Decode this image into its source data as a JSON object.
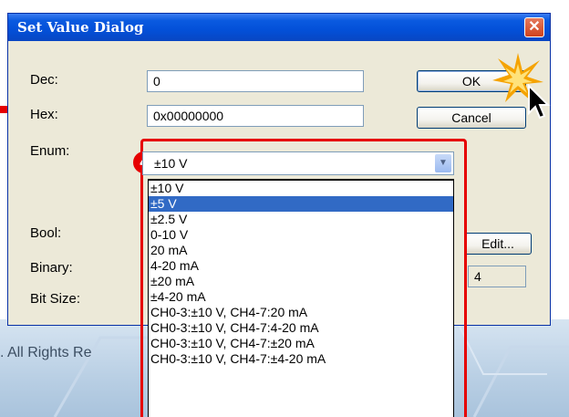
{
  "dialog": {
    "title": "Set Value Dialog",
    "close_icon": "close-icon"
  },
  "labels": {
    "dec": "Dec:",
    "hex": "Hex:",
    "enum": "Enum:",
    "bool": "Bool:",
    "binary": "Binary:",
    "bit_size": "Bit Size:"
  },
  "fields": {
    "dec_value": "0",
    "hex_value": "0x00000000",
    "bit_size_value": "4"
  },
  "buttons": {
    "ok": "OK",
    "cancel": "Cancel",
    "edit": "Edit..."
  },
  "enum_combo": {
    "selected": "±10 V",
    "options": [
      "±10 V",
      "±5 V",
      "±2.5 V",
      "0-10 V",
      "20 mA",
      "4-20 mA",
      "±20 mA",
      "±4-20 mA",
      "CH0-3:±10 V, CH4-7:20 mA",
      "CH0-3:±10 V, CH4-7:4-20 mA",
      "CH0-3:±10 V, CH4-7:±20 mA",
      "CH0-3:±10 V, CH4-7:±4-20 mA"
    ],
    "highlighted_index": 1
  },
  "annotation": {
    "step_badge": "4"
  },
  "background": {
    "copyright_fragment": ". All Rights Re"
  },
  "colors": {
    "titlebar": "#0350d8",
    "highlight": "#316ac5",
    "annotation_red": "#e60000"
  }
}
